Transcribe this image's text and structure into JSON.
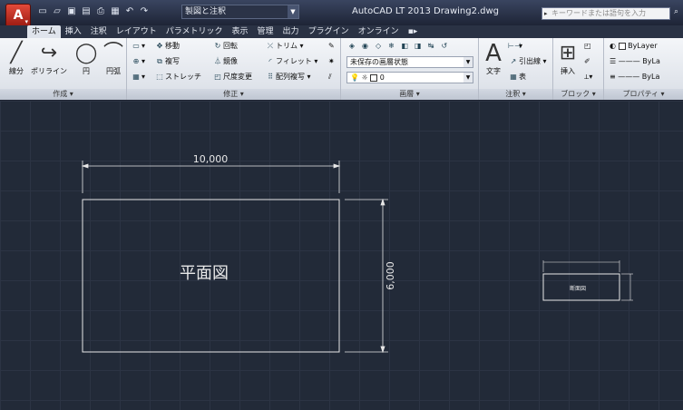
{
  "title_bar": {
    "app_title": "AutoCAD LT 2013",
    "document": "Drawing2.dwg",
    "workspace": "製図と注釈",
    "search_placeholder": "キーワードまたは語句を入力"
  },
  "tabs": [
    "ホーム",
    "挿入",
    "注釈",
    "レイアウト",
    "パラメトリック",
    "表示",
    "管理",
    "出力",
    "プラグイン",
    "オンライン"
  ],
  "active_tab": "ホーム",
  "ribbon": {
    "draw": {
      "title": "作成 ▾",
      "line": "線分",
      "polyline": "ポリライン",
      "circle": "円",
      "arc": "円弧"
    },
    "modify": {
      "title": "修正 ▾",
      "move": "移動",
      "rotate": "回転",
      "trim": "トリム ▾",
      "copy": "複写",
      "mirror": "鏡像",
      "fillet": "フィレット ▾",
      "stretch": "ストレッチ",
      "scale": "尺度変更",
      "array": "配列複写 ▾"
    },
    "layers": {
      "title": "画層 ▾",
      "state": "未保存の画層状態",
      "current": "0"
    },
    "annotation": {
      "title": "注釈 ▾",
      "text": "文字",
      "leader": "引出線 ▾",
      "table": "表"
    },
    "block": {
      "title": "ブロック ▾",
      "insert": "挿入"
    },
    "properties": {
      "title": "プロパティ ▾",
      "color": "ByLayer",
      "linetype": "ByLa",
      "lineweight": "ByLa"
    }
  },
  "drawing": {
    "plan_label": "平面図",
    "width_dim": "10,000",
    "height_dim": "6,000",
    "section_label": "断面図"
  },
  "colors": {
    "app_button": "#c8302a",
    "canvas": "#222a38",
    "grid": "#2c3444",
    "geometry": "#e8e8e8"
  }
}
